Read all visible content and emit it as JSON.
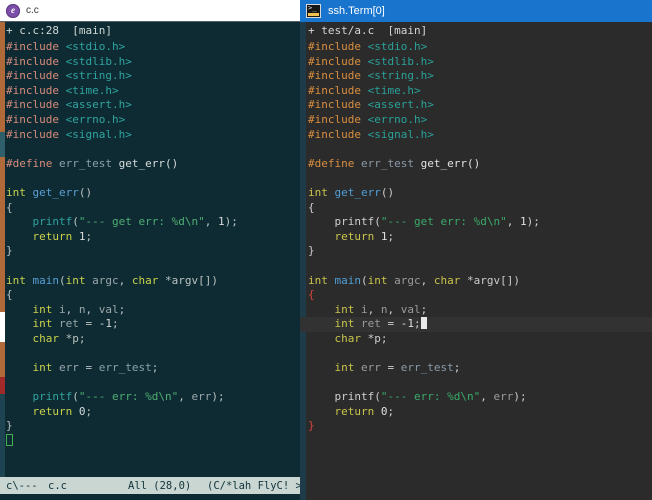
{
  "left_window": {
    "titlebar": {
      "icon": "emacs-circle-icon",
      "title": "c.c",
      "bg_color": "#ffffff"
    },
    "header": {
      "modified_marker": "+",
      "filename": "c.c:28",
      "branch": "[main]",
      "full": "+ c.c:28  [main]"
    },
    "statusbar": {
      "mode_flags": "c\\---",
      "filename": "c.c",
      "position": "All (28,0)",
      "minor_modes": "(C/*lah FlyC! >>>",
      "bg_color": "#c9d6d2"
    },
    "code_lines": [
      [
        {
          "t": "#include ",
          "c": "L-pre"
        },
        {
          "t": "<stdio.h>",
          "c": "L-inc"
        }
      ],
      [
        {
          "t": "#include ",
          "c": "L-pre"
        },
        {
          "t": "<stdlib.h>",
          "c": "L-inc"
        }
      ],
      [
        {
          "t": "#include ",
          "c": "L-pre"
        },
        {
          "t": "<string.h>",
          "c": "L-inc"
        }
      ],
      [
        {
          "t": "#include ",
          "c": "L-pre"
        },
        {
          "t": "<time.h>",
          "c": "L-inc"
        }
      ],
      [
        {
          "t": "#include ",
          "c": "L-pre"
        },
        {
          "t": "<assert.h>",
          "c": "L-inc"
        }
      ],
      [
        {
          "t": "#include ",
          "c": "L-pre"
        },
        {
          "t": "<errno.h>",
          "c": "L-inc"
        }
      ],
      [
        {
          "t": "#include ",
          "c": "L-pre"
        },
        {
          "t": "<signal.h>",
          "c": "L-inc"
        }
      ],
      [],
      [
        {
          "t": "#define ",
          "c": "L-pre"
        },
        {
          "t": "err_test ",
          "c": "L-macro"
        },
        {
          "t": "get_err()",
          "c": "L-plain"
        }
      ],
      [],
      [
        {
          "t": "int ",
          "c": "L-type"
        },
        {
          "t": "get_err",
          "c": "L-fn"
        },
        {
          "t": "()",
          "c": "L-punct"
        }
      ],
      [
        {
          "t": "{",
          "c": "L-brace"
        }
      ],
      [
        {
          "t": "    printf",
          "c": "L-call"
        },
        {
          "t": "(",
          "c": "L-punct"
        },
        {
          "t": "\"--- get err: %d\\n\"",
          "c": "L-str"
        },
        {
          "t": ", ",
          "c": "L-punct"
        },
        {
          "t": "1",
          "c": "L-num"
        },
        {
          "t": ");",
          "c": "L-punct"
        }
      ],
      [
        {
          "t": "    return ",
          "c": "L-type"
        },
        {
          "t": "1",
          "c": "L-num"
        },
        {
          "t": ";",
          "c": "L-punct"
        }
      ],
      [
        {
          "t": "}",
          "c": "L-brace"
        }
      ],
      [],
      [
        {
          "t": "int ",
          "c": "L-type"
        },
        {
          "t": "main",
          "c": "L-fn"
        },
        {
          "t": "(",
          "c": "L-punct"
        },
        {
          "t": "int ",
          "c": "L-type"
        },
        {
          "t": "argc",
          "c": "L-var"
        },
        {
          "t": ", ",
          "c": "L-punct"
        },
        {
          "t": "char ",
          "c": "L-type"
        },
        {
          "t": "*argv[])",
          "c": "L-punct"
        }
      ],
      [
        {
          "t": "{",
          "c": "L-brace"
        }
      ],
      [
        {
          "t": "    int ",
          "c": "L-type"
        },
        {
          "t": "i",
          "c": "L-var"
        },
        {
          "t": ", ",
          "c": "L-punct"
        },
        {
          "t": "n",
          "c": "L-var"
        },
        {
          "t": ", ",
          "c": "L-punct"
        },
        {
          "t": "val",
          "c": "L-var"
        },
        {
          "t": ";",
          "c": "L-punct"
        }
      ],
      [
        {
          "t": "    int ",
          "c": "L-type"
        },
        {
          "t": "ret ",
          "c": "L-var"
        },
        {
          "t": "= ",
          "c": "L-punct"
        },
        {
          "t": "-1",
          "c": "L-num"
        },
        {
          "t": ";",
          "c": "L-punct"
        }
      ],
      [
        {
          "t": "    char ",
          "c": "L-type"
        },
        {
          "t": "*p;",
          "c": "L-punct"
        }
      ],
      [],
      [
        {
          "t": "    int ",
          "c": "L-type"
        },
        {
          "t": "err ",
          "c": "L-var"
        },
        {
          "t": "= ",
          "c": "L-punct"
        },
        {
          "t": "err_test",
          "c": "L-macro"
        },
        {
          "t": ";",
          "c": "L-punct"
        }
      ],
      [],
      [
        {
          "t": "    printf",
          "c": "L-call"
        },
        {
          "t": "(",
          "c": "L-punct"
        },
        {
          "t": "\"--- err: %d\\n\"",
          "c": "L-str"
        },
        {
          "t": ", ",
          "c": "L-punct"
        },
        {
          "t": "err",
          "c": "L-var"
        },
        {
          "t": ");",
          "c": "L-punct"
        }
      ],
      [
        {
          "t": "    return ",
          "c": "L-type"
        },
        {
          "t": "0",
          "c": "L-num"
        },
        {
          "t": ";",
          "c": "L-punct"
        }
      ],
      [
        {
          "t": "}",
          "c": "L-brace"
        }
      ]
    ],
    "cursor": {
      "kind": "hollow-box",
      "line_index": 27,
      "col": 0,
      "color": "#3fae52"
    }
  },
  "right_window": {
    "titlebar": {
      "icon": "terminal-icon",
      "title": "ssh.Term[0]",
      "bg_color": "#1874cd",
      "active": true
    },
    "header": {
      "modified_marker": "+",
      "filename": "test/a.c",
      "branch": "[main]",
      "full": "+ test/a.c  [main]"
    },
    "code_lines": [
      [
        {
          "t": "#include ",
          "c": "R-pre"
        },
        {
          "t": "<stdio.h>",
          "c": "R-inc"
        }
      ],
      [
        {
          "t": "#include ",
          "c": "R-pre"
        },
        {
          "t": "<stdlib.h>",
          "c": "R-inc"
        }
      ],
      [
        {
          "t": "#include ",
          "c": "R-pre"
        },
        {
          "t": "<string.h>",
          "c": "R-inc"
        }
      ],
      [
        {
          "t": "#include ",
          "c": "R-pre"
        },
        {
          "t": "<time.h>",
          "c": "R-inc"
        }
      ],
      [
        {
          "t": "#include ",
          "c": "R-pre"
        },
        {
          "t": "<assert.h>",
          "c": "R-inc"
        }
      ],
      [
        {
          "t": "#include ",
          "c": "R-pre"
        },
        {
          "t": "<errno.h>",
          "c": "R-inc"
        }
      ],
      [
        {
          "t": "#include ",
          "c": "R-pre"
        },
        {
          "t": "<signal.h>",
          "c": "R-inc"
        }
      ],
      [],
      [
        {
          "t": "#define ",
          "c": "R-pre"
        },
        {
          "t": "err_test ",
          "c": "R-macro"
        },
        {
          "t": "get_err()",
          "c": "R-plain"
        }
      ],
      [],
      [
        {
          "t": "int ",
          "c": "R-type"
        },
        {
          "t": "get_err",
          "c": "R-fn"
        },
        {
          "t": "()",
          "c": "R-punct"
        }
      ],
      [
        {
          "t": "{",
          "c": "R-brace"
        }
      ],
      [
        {
          "t": "    printf",
          "c": "R-call"
        },
        {
          "t": "(",
          "c": "R-punct"
        },
        {
          "t": "\"--- get err: %d\\n\"",
          "c": "R-str"
        },
        {
          "t": ", ",
          "c": "R-punct"
        },
        {
          "t": "1",
          "c": "R-num"
        },
        {
          "t": ");",
          "c": "R-punct"
        }
      ],
      [
        {
          "t": "    return ",
          "c": "R-type"
        },
        {
          "t": "1",
          "c": "R-num"
        },
        {
          "t": ";",
          "c": "R-punct"
        }
      ],
      [
        {
          "t": "}",
          "c": "R-brace"
        }
      ],
      [],
      [
        {
          "t": "int ",
          "c": "R-type"
        },
        {
          "t": "main",
          "c": "R-fn"
        },
        {
          "t": "(",
          "c": "R-punct"
        },
        {
          "t": "int ",
          "c": "R-type"
        },
        {
          "t": "argc",
          "c": "R-var"
        },
        {
          "t": ", ",
          "c": "R-punct"
        },
        {
          "t": "char ",
          "c": "R-type"
        },
        {
          "t": "*argv[])",
          "c": "R-punct"
        }
      ],
      [
        {
          "t": "{",
          "c": "R-bracehl"
        }
      ],
      [
        {
          "t": "    int ",
          "c": "R-type"
        },
        {
          "t": "i",
          "c": "R-var"
        },
        {
          "t": ", ",
          "c": "R-punct"
        },
        {
          "t": "n",
          "c": "R-var"
        },
        {
          "t": ", ",
          "c": "R-punct"
        },
        {
          "t": "val",
          "c": "R-var"
        },
        {
          "t": ";",
          "c": "R-punct"
        }
      ],
      [
        {
          "t": "    int ",
          "c": "R-type"
        },
        {
          "t": "ret ",
          "c": "R-var"
        },
        {
          "t": "= ",
          "c": "R-punct"
        },
        {
          "t": "-1",
          "c": "R-num"
        },
        {
          "t": ";",
          "c": "R-punct"
        }
      ],
      [
        {
          "t": "    char ",
          "c": "R-type"
        },
        {
          "t": "*p;",
          "c": "R-punct"
        }
      ],
      [],
      [
        {
          "t": "    int ",
          "c": "R-type"
        },
        {
          "t": "err ",
          "c": "R-var"
        },
        {
          "t": "= ",
          "c": "R-punct"
        },
        {
          "t": "err_test",
          "c": "R-macro"
        },
        {
          "t": ";",
          "c": "R-punct"
        }
      ],
      [],
      [
        {
          "t": "    printf",
          "c": "R-call"
        },
        {
          "t": "(",
          "c": "R-punct"
        },
        {
          "t": "\"--- err: %d\\n\"",
          "c": "R-str"
        },
        {
          "t": ", ",
          "c": "R-punct"
        },
        {
          "t": "err",
          "c": "R-var"
        },
        {
          "t": ");",
          "c": "R-punct"
        }
      ],
      [
        {
          "t": "    return ",
          "c": "R-type"
        },
        {
          "t": "0",
          "c": "R-num"
        },
        {
          "t": ";",
          "c": "R-punct"
        }
      ],
      [
        {
          "t": "}",
          "c": "R-bracehl"
        }
      ]
    ],
    "cursor": {
      "kind": "block",
      "line_index": 19,
      "after_text": "    int ret = -1;",
      "color": "#e8e8e8"
    },
    "highlight_line_index": 19
  }
}
